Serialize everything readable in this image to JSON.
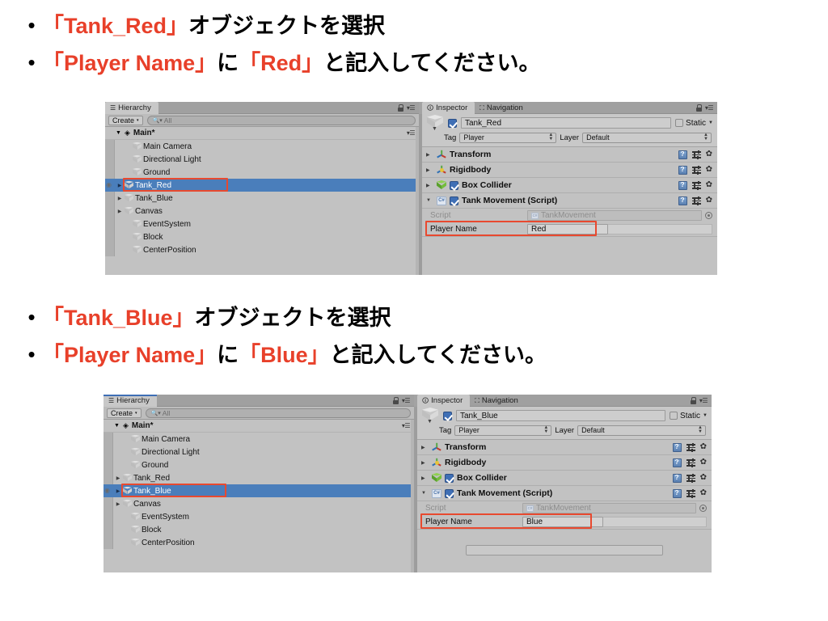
{
  "sections": [
    {
      "bullets": [
        [
          {
            "t": "「Tank_Red」",
            "c": "red"
          },
          {
            "t": "オブジェクトを選択",
            "c": "black"
          }
        ],
        [
          {
            "t": "「Player Name」",
            "c": "red"
          },
          {
            "t": "に",
            "c": "black"
          },
          {
            "t": "「Red」",
            "c": "red"
          },
          {
            "t": "と記入してください。",
            "c": "black"
          }
        ]
      ],
      "hierarchy": {
        "tab_label": "Hierarchy",
        "tab_icon": "hierarchy-list-icon",
        "create_label": "Create",
        "search_placeholder": "All",
        "search_icon": "search-icon",
        "lock_icon": "lock-icon",
        "menu_icon": "panel-menu-icon",
        "scene_root": "Main*",
        "items": [
          {
            "name": "Main Camera",
            "indent": 2,
            "expandable": false,
            "selected": false
          },
          {
            "name": "Directional Light",
            "indent": 2,
            "expandable": false,
            "selected": false
          },
          {
            "name": "Ground",
            "indent": 2,
            "expandable": false,
            "selected": false
          },
          {
            "name": "Tank_Red",
            "indent": 1,
            "expandable": true,
            "selected": true
          },
          {
            "name": "Tank_Blue",
            "indent": 1,
            "expandable": true,
            "selected": false
          },
          {
            "name": "Canvas",
            "indent": 1,
            "expandable": true,
            "selected": false
          },
          {
            "name": "EventSystem",
            "indent": 2,
            "expandable": false,
            "selected": false
          },
          {
            "name": "Block",
            "indent": 2,
            "expandable": false,
            "selected": false
          },
          {
            "name": "CenterPosition",
            "indent": 2,
            "expandable": false,
            "selected": false
          }
        ]
      },
      "inspector": {
        "tab_label": "Inspector",
        "tab_icon": "info-icon",
        "nav_tab_label": "Navigation",
        "nav_tab_icon": "navigation-icon",
        "lock_icon": "lock-icon",
        "menu_icon": "panel-menu-icon",
        "object_name": "Tank_Red",
        "object_enabled": true,
        "static_label": "Static",
        "static_checked": false,
        "tag_label": "Tag",
        "tag_value": "Player",
        "layer_label": "Layer",
        "layer_value": "Default",
        "components": [
          {
            "name": "Transform",
            "icon": "transform-axis-icon",
            "expanded": false,
            "has_checkbox": false
          },
          {
            "name": "Rigidbody",
            "icon": "rigidbody-icon",
            "expanded": false,
            "has_checkbox": false
          },
          {
            "name": "Box Collider",
            "icon": "box-collider-icon",
            "expanded": false,
            "has_checkbox": true
          },
          {
            "name": "Tank Movement (Script)",
            "icon": "csharp-script-icon",
            "expanded": true,
            "has_checkbox": true
          }
        ],
        "script_label": "Script",
        "script_value": "TankMovement",
        "player_name_label": "Player Name",
        "player_name_value": "Red",
        "help_icon": "help-book-icon",
        "preset_icon": "preset-sliders-icon",
        "gear_icon": "gear-icon",
        "object_picker_icon": "object-picker-icon"
      }
    },
    {
      "bullets": [
        [
          {
            "t": "「Tank_Blue」",
            "c": "red"
          },
          {
            "t": "オブジェクトを選択",
            "c": "black"
          }
        ],
        [
          {
            "t": "「Player Name」",
            "c": "red"
          },
          {
            "t": "に",
            "c": "black"
          },
          {
            "t": "「Blue」",
            "c": "red"
          },
          {
            "t": "と記入してください。",
            "c": "black"
          }
        ]
      ],
      "hierarchy": {
        "tab_label": "Hierarchy",
        "tab_icon": "hierarchy-list-icon",
        "create_label": "Create",
        "search_placeholder": "All",
        "search_icon": "search-icon",
        "lock_icon": "lock-icon",
        "menu_icon": "panel-menu-icon",
        "scene_root": "Main*",
        "items": [
          {
            "name": "Main Camera",
            "indent": 2,
            "expandable": false,
            "selected": false
          },
          {
            "name": "Directional Light",
            "indent": 2,
            "expandable": false,
            "selected": false
          },
          {
            "name": "Ground",
            "indent": 2,
            "expandable": false,
            "selected": false
          },
          {
            "name": "Tank_Red",
            "indent": 1,
            "expandable": true,
            "selected": false
          },
          {
            "name": "Tank_Blue",
            "indent": 1,
            "expandable": true,
            "selected": true
          },
          {
            "name": "Canvas",
            "indent": 1,
            "expandable": true,
            "selected": false
          },
          {
            "name": "EventSystem",
            "indent": 2,
            "expandable": false,
            "selected": false
          },
          {
            "name": "Block",
            "indent": 2,
            "expandable": false,
            "selected": false
          },
          {
            "name": "CenterPosition",
            "indent": 2,
            "expandable": false,
            "selected": false
          }
        ]
      },
      "inspector": {
        "tab_label": "Inspector",
        "tab_icon": "info-icon",
        "nav_tab_label": "Navigation",
        "nav_tab_icon": "navigation-icon",
        "lock_icon": "lock-icon",
        "menu_icon": "panel-menu-icon",
        "object_name": "Tank_Blue",
        "object_enabled": true,
        "static_label": "Static",
        "static_checked": false,
        "tag_label": "Tag",
        "tag_value": "Player",
        "layer_label": "Layer",
        "layer_value": "Default",
        "components": [
          {
            "name": "Transform",
            "icon": "transform-axis-icon",
            "expanded": false,
            "has_checkbox": false
          },
          {
            "name": "Rigidbody",
            "icon": "rigidbody-icon",
            "expanded": false,
            "has_checkbox": false
          },
          {
            "name": "Box Collider",
            "icon": "box-collider-icon",
            "expanded": false,
            "has_checkbox": true
          },
          {
            "name": "Tank Movement (Script)",
            "icon": "csharp-script-icon",
            "expanded": true,
            "has_checkbox": true
          }
        ],
        "script_label": "Script",
        "script_value": "TankMovement",
        "player_name_label": "Player Name",
        "player_name_value": "Blue",
        "help_icon": "help-book-icon",
        "preset_icon": "preset-sliders-icon",
        "gear_icon": "gear-icon",
        "object_picker_icon": "object-picker-icon"
      }
    }
  ],
  "colors": {
    "accent_red": "#e8402a",
    "highlight_box": "#e8492f",
    "selection_blue": "#4a7ebb",
    "panel_gray": "#c2c2c2"
  }
}
